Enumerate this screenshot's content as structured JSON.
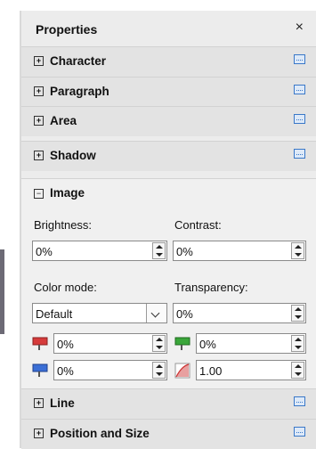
{
  "panel": {
    "title": "Properties",
    "close_glyph": "×"
  },
  "sections": {
    "character": {
      "label": "Character",
      "toggle": "+"
    },
    "paragraph": {
      "label": "Paragraph",
      "toggle": "+"
    },
    "area": {
      "label": "Area",
      "toggle": "+"
    },
    "shadow": {
      "label": "Shadow",
      "toggle": "+"
    },
    "image": {
      "label": "Image",
      "toggle": "−"
    },
    "line": {
      "label": "Line",
      "toggle": "+"
    },
    "position_size": {
      "label": "Position and Size",
      "toggle": "+"
    }
  },
  "image": {
    "brightness_label": "Brightness:",
    "brightness_value": "0%",
    "contrast_label": "Contrast:",
    "contrast_value": "0%",
    "color_mode_label": "Color mode:",
    "color_mode_value": "Default",
    "transparency_label": "Transparency:",
    "transparency_value": "0%",
    "red_value": "0%",
    "green_value": "0%",
    "blue_value": "0%",
    "gamma_value": "1.00"
  },
  "colors": {
    "red": "#d63b3b",
    "green": "#3aa63a",
    "blue": "#3b6fd6",
    "more_button": "#3a78c8"
  },
  "icons": [
    "close-icon",
    "expand-icon",
    "collapse-icon",
    "more-options-icon",
    "red-channel-icon",
    "green-channel-icon",
    "blue-channel-icon",
    "gamma-icon",
    "dropdown-arrow-icon",
    "spin-arrows-icon"
  ]
}
